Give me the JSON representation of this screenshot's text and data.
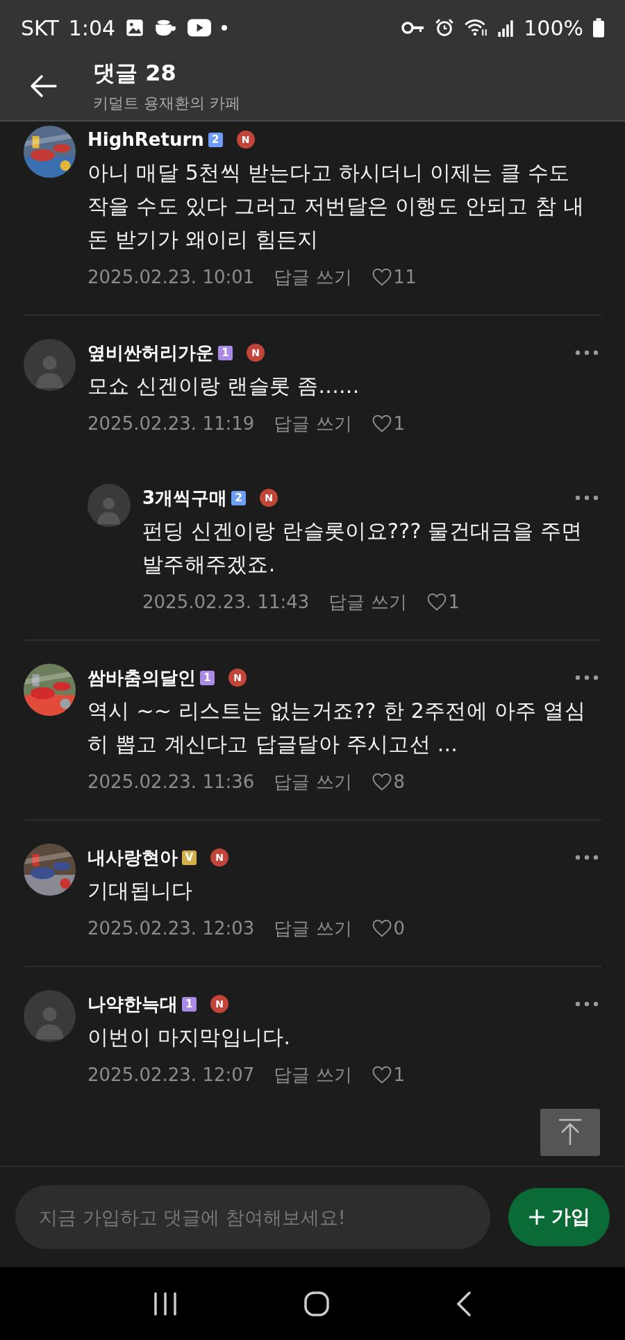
{
  "status_bar": {
    "carrier": "SKT",
    "time": "1:04",
    "battery": "100%"
  },
  "header": {
    "title": "댓글 28",
    "subtitle": "키덜트 용재환의 카페"
  },
  "comments": [
    {
      "author": "HighReturn",
      "level_badge": {
        "text": "2",
        "color": "#6d9ef5"
      },
      "new_badge": "N",
      "menu": false,
      "text": "아니 매달 5천씩 받는다고 하시더니 이제는 클 수도 작을 수도 있다 그러고 저번달은 이행도 안되고 참 내돈 받기가 왜이리 힘든지",
      "date": "2025.02.23. 10:01",
      "reply_label": "답글 쓰기",
      "likes": "11"
    },
    {
      "author": "옆비싼허리가운",
      "avatar": {
        "kind": "default"
      },
      "level_badge": {
        "text": "1",
        "color": "#a98be6"
      },
      "new_badge": "N",
      "menu": true,
      "text": "모쇼 신겐이랑 랜슬롯 좀......",
      "date": "2025.02.23. 11:19",
      "reply_label": "답글 쓰기",
      "likes": "1",
      "children": [
        {
          "author": "3개씩구매",
          "avatar": {
            "kind": "default"
          },
          "level_badge": {
            "text": "2",
            "color": "#6d9ef5"
          },
          "new_badge": "N",
          "menu": true,
          "text": "펀딩 신겐이랑 란슬롯이요??? 물건대금을 주면 발주해주겠죠.",
          "date": "2025.02.23. 11:43",
          "reply_label": "답글 쓰기",
          "likes": "1"
        }
      ]
    },
    {
      "author": "쌈바춤의달인",
      "level_badge": {
        "text": "1",
        "color": "#a98be6"
      },
      "new_badge": "N",
      "menu": true,
      "text": "역시 ~~ 리스트는 없는거죠?? 한 2주전에 아주 열심히 뽑고 계신다고 답글달아 주시고선 ...",
      "date": "2025.02.23. 11:36",
      "reply_label": "답글 쓰기",
      "likes": "8"
    },
    {
      "author": "내사랑현아",
      "level_badge": {
        "text": "V",
        "color": "#d4b04a"
      },
      "new_badge": "N",
      "menu": true,
      "text": "기대됩니다",
      "date": "2025.02.23. 12:03",
      "reply_label": "답글 쓰기",
      "likes": "0"
    },
    {
      "author": "나약한늑대",
      "avatar": {
        "kind": "default"
      },
      "level_badge": {
        "text": "1",
        "color": "#a98be6"
      },
      "new_badge": "N",
      "menu": true,
      "text": "이번이 마지막입니다.",
      "date": "2025.02.23. 12:07",
      "reply_label": "답글 쓰기",
      "likes": "1"
    }
  ],
  "comment_input": {
    "placeholder": "지금 가입하고 댓글에 참여해보세요!"
  },
  "join_button": {
    "label": "가입"
  }
}
